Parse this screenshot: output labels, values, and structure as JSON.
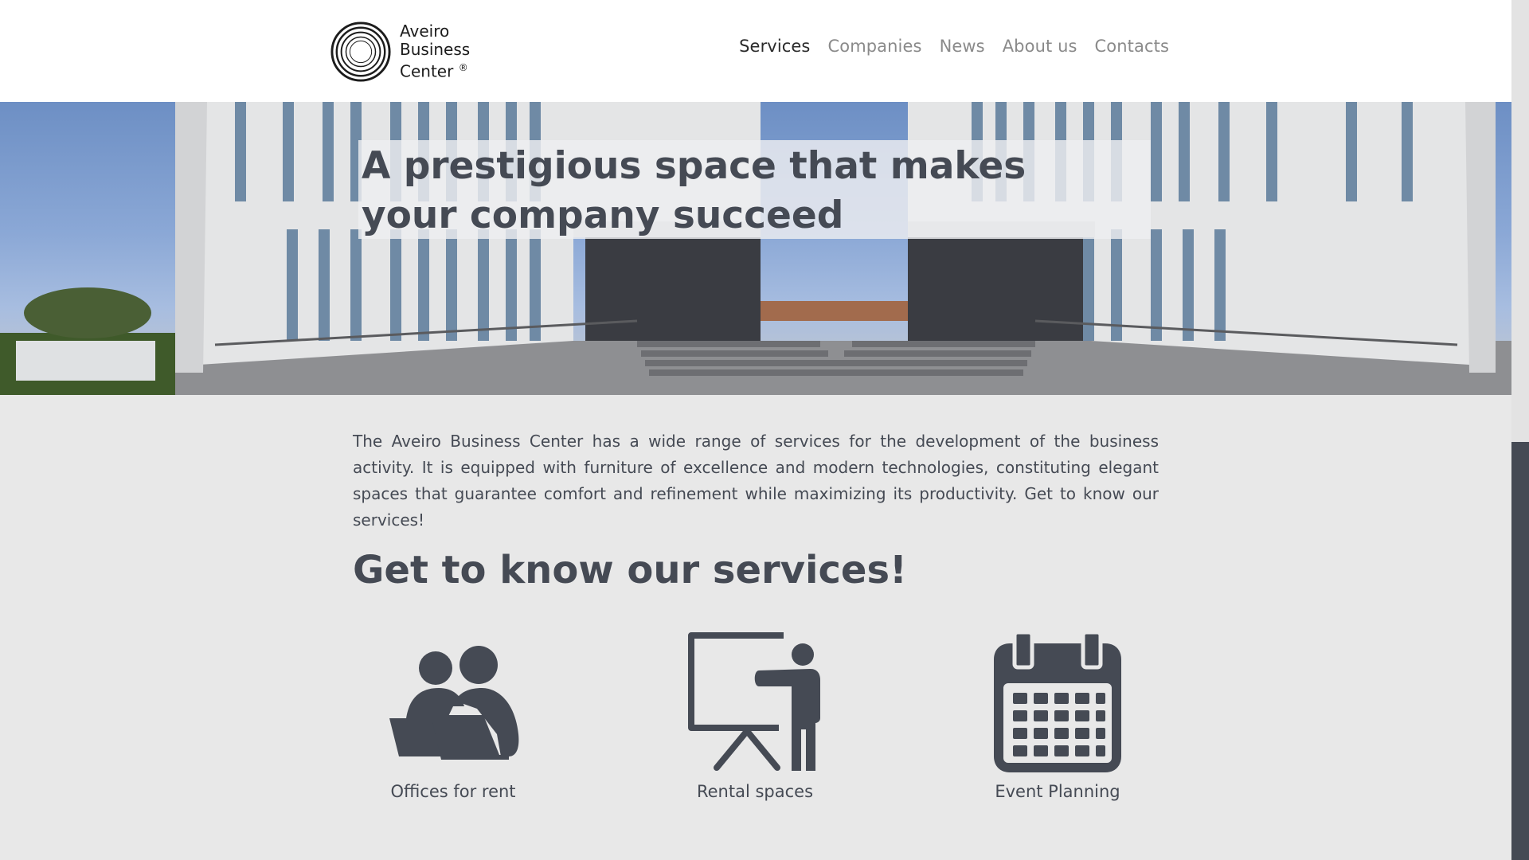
{
  "header": {
    "logo": {
      "line1": "Aveiro",
      "line2": "Business",
      "line3": "Center",
      "mark": "®"
    },
    "nav": [
      {
        "label": "Services",
        "active": true
      },
      {
        "label": "Companies",
        "active": false
      },
      {
        "label": "News",
        "active": false
      },
      {
        "label": "About us",
        "active": false
      },
      {
        "label": "Contacts",
        "active": false
      }
    ]
  },
  "hero": {
    "title": "A prestigious space that makes your company succeed"
  },
  "intro": {
    "text": "The Aveiro Business Center has a wide range of services for the development of the business activity. It is equipped with furniture of excellence and modern technologies, constituting elegant spaces that guarantee comfort and refinement while maximizing its productivity. Get to know our services!"
  },
  "services": {
    "heading": "Get to know our services!",
    "items": [
      {
        "label": "Offices for rent",
        "icon": "people-laptop-icon"
      },
      {
        "label": "Rental spaces",
        "icon": "presentation-board-icon"
      },
      {
        "label": "Event Planning",
        "icon": "calendar-icon"
      }
    ]
  },
  "colors": {
    "text": "#454a54",
    "background": "#e8e8e8",
    "nav_inactive": "#8a8a8a",
    "nav_active": "#2b2b2b"
  }
}
